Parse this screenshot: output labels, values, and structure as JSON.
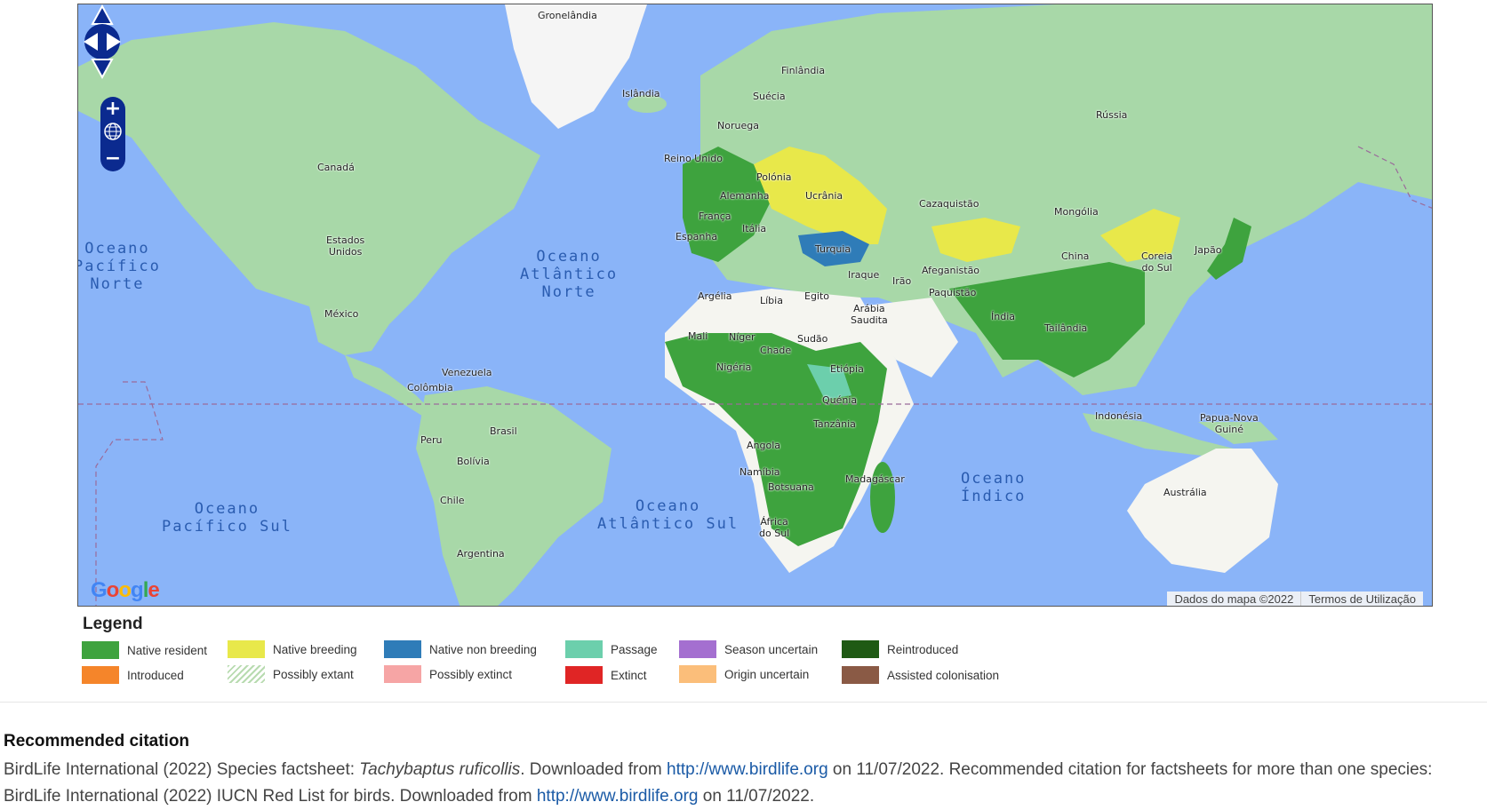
{
  "map": {
    "labels": {
      "gronelandia": "Gronelândia",
      "islandia": "Islândia",
      "finlandia": "Finlândia",
      "suecia": "Suécia",
      "noruega": "Noruega",
      "russia": "Rússia",
      "reino_unido": "Reino Unido",
      "polonia": "Polónia",
      "alemanha": "Alemanha",
      "ucrania": "Ucrânia",
      "franca": "França",
      "cazaquistao": "Cazaquistão",
      "mongolia": "Mongólia",
      "espanha": "Espanha",
      "italia": "Itália",
      "turquia": "Turquia",
      "canada": "Canadá",
      "estados_unidos": "Estados\nUnidos",
      "mexico": "México",
      "argelia": "Argélia",
      "libia": "Líbia",
      "egito": "Egito",
      "iraque": "Iraque",
      "irao": "Irão",
      "afeganistao": "Afeganistão",
      "paquistao": "Paquistão",
      "china": "China",
      "coreia_do_sul": "Coreia\ndo Sul",
      "japao": "Japão",
      "arabia_saudita": "Arábia\nSaudita",
      "india": "Índia",
      "tailandia": "Tailândia",
      "mali": "Mali",
      "niger": "Níger",
      "chade": "Chade",
      "sudao": "Sudão",
      "nigeria": "Nigéria",
      "etiopia": "Etiópia",
      "venezuela": "Venezuela",
      "colombia": "Colômbia",
      "quenia": "Quénia",
      "tanzania": "Tanzânia",
      "indonesia": "Indonésia",
      "papua": "Papua-Nova\nGuiné",
      "peru": "Peru",
      "brasil": "Brasil",
      "bolivia": "Bolívia",
      "angola": "Angola",
      "namibia": "Namíbia",
      "botsuana": "Botsuana",
      "madagascar": "Madagáscar",
      "australia": "Austrália",
      "chile": "Chile",
      "africa_do_sul": "África\ndo Sul",
      "argentina": "Argentina"
    },
    "oceans": {
      "pacifico_norte": "Oceano\nPacífico\nNorte",
      "atlantico_norte": "Oceano\nAtlântico\nNorte",
      "pacifico_sul": "Oceano\nPacífico Sul",
      "atlantico_sul": "Oceano\nAtlântico Sul",
      "indico": "Oceano\nÍndico"
    },
    "attribution": "Dados do mapa ©2022",
    "terms": "Termos de Utilização",
    "google": "Google",
    "controls": {
      "zoom_in": "+",
      "zoom_out": "−"
    }
  },
  "legend": {
    "title": "Legend",
    "items": [
      {
        "label": "Native resident",
        "color": "#3ea33e"
      },
      {
        "label": "Native breeding",
        "color": "#e8e84a"
      },
      {
        "label": "Native non breeding",
        "color": "#2f7cb8"
      },
      {
        "label": "Passage",
        "color": "#6ccfac"
      },
      {
        "label": "Season uncertain",
        "color": "#a46fd0"
      },
      {
        "label": "Reintroduced",
        "color": "#1f5a14"
      },
      {
        "label": "Introduced",
        "color": "#f5852a"
      },
      {
        "label": "Possibly extant",
        "color": "hatched"
      },
      {
        "label": "Possibly extinct",
        "color": "#f6a5a5"
      },
      {
        "label": "Extinct",
        "color": "#e02525"
      },
      {
        "label": "Origin uncertain",
        "color": "#fbbe7a"
      },
      {
        "label": "Assisted colonisation",
        "color": "#8a5a45"
      }
    ]
  },
  "citation": {
    "title": "Recommended citation",
    "part1": "BirdLife International (2022) Species factsheet: ",
    "species": "Tachybaptus ruficollis",
    "part2": ". Downloaded from ",
    "link1": "http://www.birdlife.org",
    "part3": " on 11/07/2022. Recommended citation for factsheets for more than one species: BirdLife International (2022) IUCN Red List for birds. Downloaded from ",
    "link2": "http://www.birdlife.org",
    "part4": " on 11/07/2022."
  }
}
